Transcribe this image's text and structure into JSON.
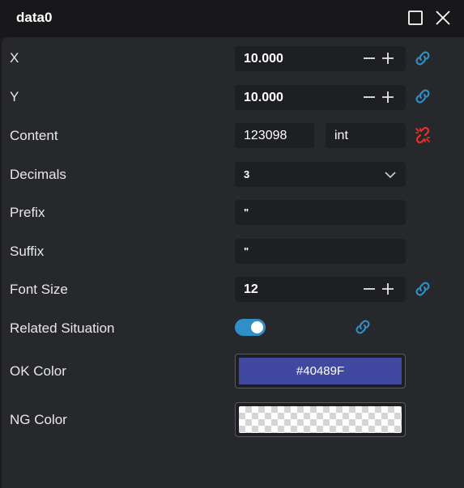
{
  "window": {
    "title": "data0"
  },
  "colors": {
    "accent": "#2f8fc6",
    "link": "#2f8fc6",
    "unlink": "#e0342b",
    "ok_swatch": "#40489F"
  },
  "icons": {
    "maximize": "maximize-icon",
    "close": "close-icon",
    "link": "link-icon",
    "unlink": "unlink-icon",
    "plus": "plus-icon",
    "minus": "minus-icon",
    "chevron": "chevron-down-icon"
  },
  "props": {
    "x": {
      "label": "X",
      "value": "10.000"
    },
    "y": {
      "label": "Y",
      "value": "10.000"
    },
    "content": {
      "label": "Content",
      "value": "123098",
      "type": "int"
    },
    "decimals": {
      "label": "Decimals",
      "value": "3"
    },
    "prefix": {
      "label": "Prefix",
      "value": "\""
    },
    "suffix": {
      "label": "Suffix",
      "value": "\""
    },
    "font_size": {
      "label": "Font Size",
      "value": "12"
    },
    "related": {
      "label": "Related Situation",
      "enabled": true
    },
    "ok_color": {
      "label": "OK Color",
      "value": "#40489F"
    },
    "ng_color": {
      "label": "NG Color",
      "value": ""
    }
  }
}
